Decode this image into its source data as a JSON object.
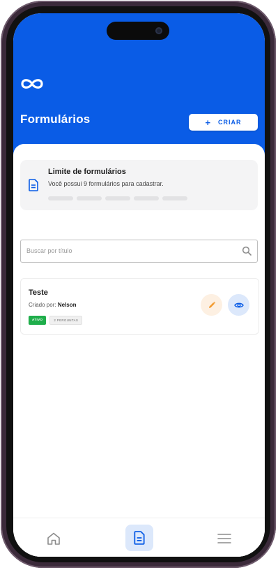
{
  "colors": {
    "brand": "#0a5ce6",
    "active_badge": "#1fae4b",
    "edit_accent": "#f29a2e",
    "nav_active_bg": "#dce8fb"
  },
  "header": {
    "logo_icon": "infinity-logo",
    "title": "Formulários",
    "create_button": {
      "icon": "plus",
      "label": "CRIAR"
    }
  },
  "limit_card": {
    "icon": "document-icon",
    "title": "Limite de formulários",
    "subtitle": "Você possui 9 formulários para cadastrar.",
    "segments": 5,
    "used": 0
  },
  "search": {
    "placeholder": "Buscar por título",
    "icon": "search-icon"
  },
  "forms": [
    {
      "title": "Teste",
      "created_by_label": "Criado por:",
      "created_by": "Nelson",
      "status_badge": "ATIVO",
      "questions_badge": "2 PERGUNTAS",
      "actions": [
        "edit-icon",
        "view-icon"
      ]
    }
  ],
  "bottom_nav": {
    "items": [
      {
        "icon": "home-icon",
        "active": false
      },
      {
        "icon": "document-icon",
        "active": true
      },
      {
        "icon": "menu-icon",
        "active": false
      }
    ]
  }
}
